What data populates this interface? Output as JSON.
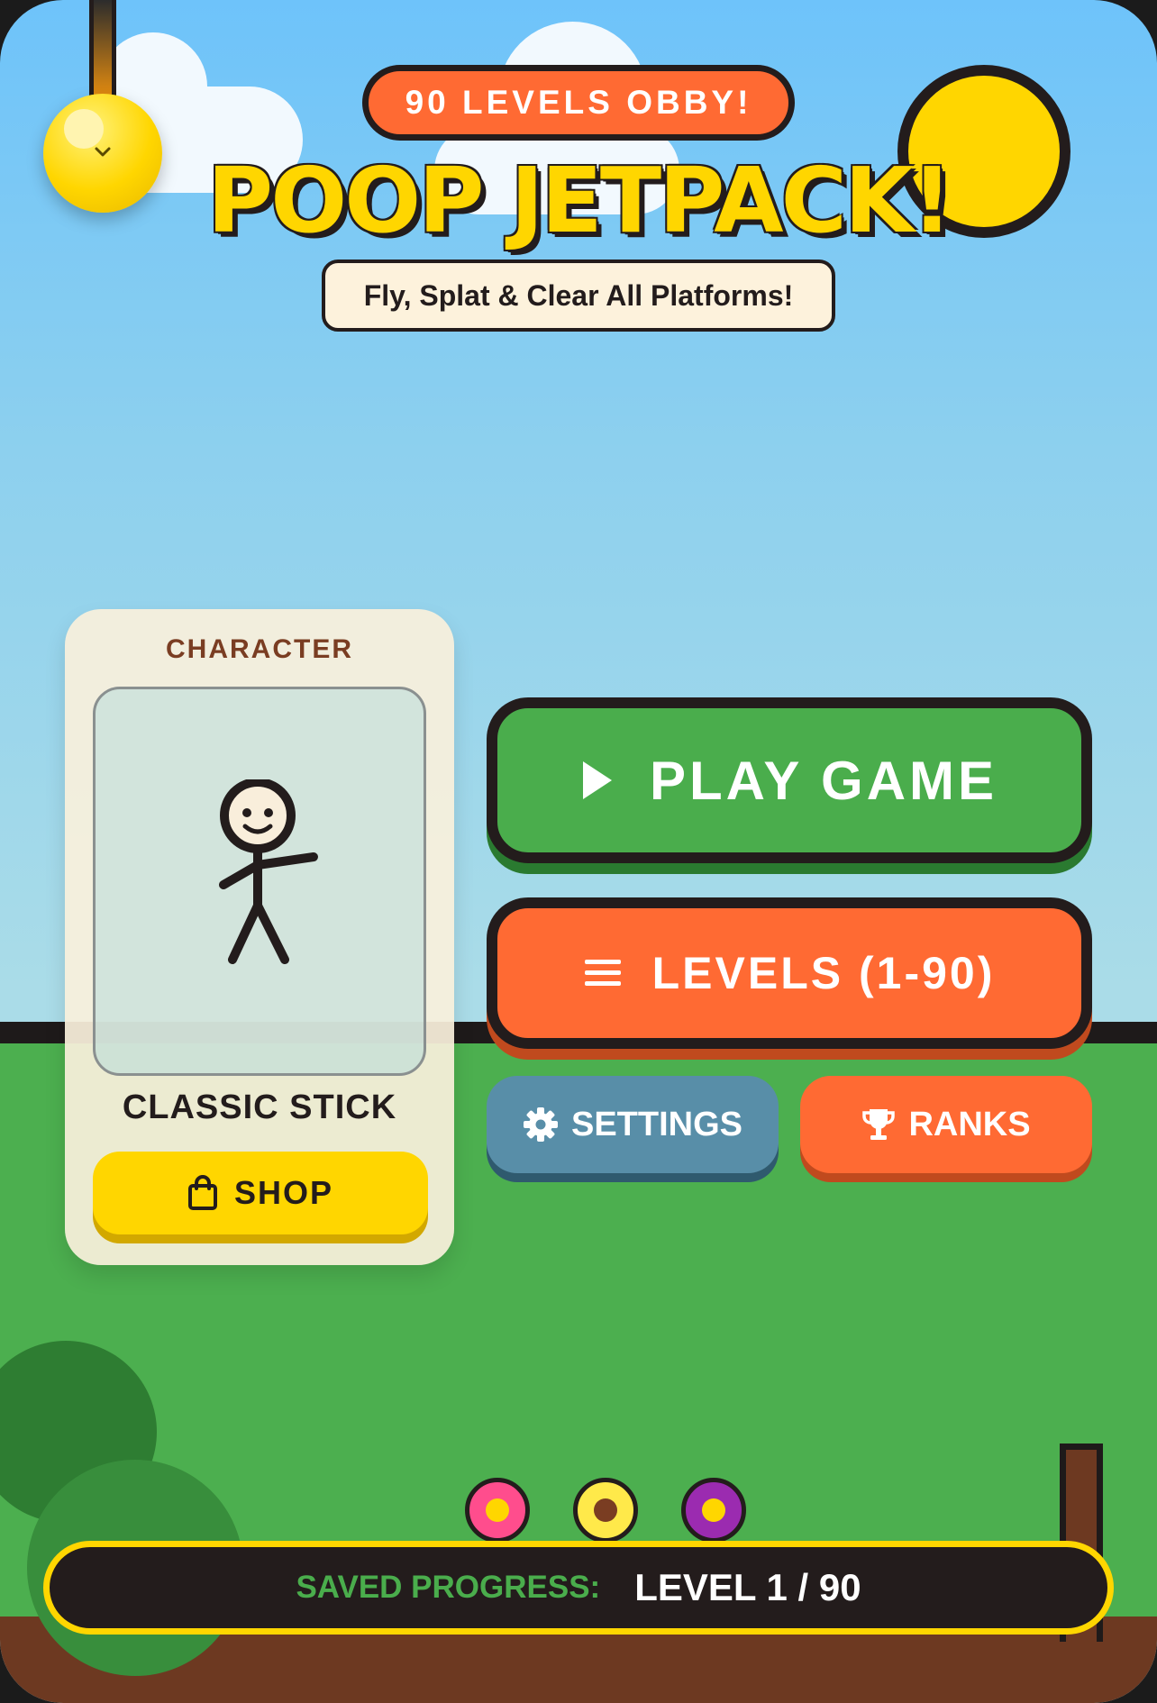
{
  "header": {
    "badge": "90 LEVELS OBBY!",
    "title": "POOP JETPACK!",
    "subtitle": "Fly, Splat & Clear All Platforms!"
  },
  "character_panel": {
    "label": "CHARACTER",
    "name": "CLASSIC STICK",
    "shop_label": "SHOP",
    "shop_icon": "shopping-bag-icon"
  },
  "menu": {
    "play_label": "PLAY GAME",
    "play_icon": "play-icon",
    "levels_label": "LEVELS (1-90)",
    "levels_icon": "list-icon",
    "settings_label": "SETTINGS",
    "settings_icon": "gear-icon",
    "ranks_label": "RANKS",
    "ranks_icon": "trophy-icon"
  },
  "progress": {
    "label": "SAVED PROGRESS:",
    "value": "LEVEL 1 / 90",
    "current_level": 1,
    "total_levels": 90
  },
  "colors": {
    "sky": "#6ec3fa",
    "grass": "#4caf4f",
    "dirt": "#6d3921",
    "accent_orange": "#ff6a33",
    "accent_yellow": "#ffd600",
    "play_green": "#4aad4c",
    "settings_blue": "#588ea8",
    "outline": "#231c1c"
  },
  "flowers": [
    {
      "petal": "#ff4d8d",
      "center": "#ffd600"
    },
    {
      "petal": "#ffe94a",
      "center": "#7a3d22"
    },
    {
      "petal": "#9b2bb0",
      "center": "#ffd600"
    }
  ]
}
